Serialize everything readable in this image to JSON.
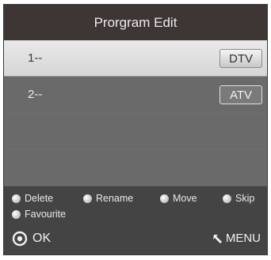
{
  "header": {
    "title": "Prorgram Edit"
  },
  "programs": [
    {
      "number": "1--",
      "type": "DTV",
      "selected": true
    },
    {
      "number": "2--",
      "type": "ATV",
      "selected": false
    },
    {
      "number": "",
      "type": "",
      "selected": false
    },
    {
      "number": "",
      "type": "",
      "selected": false
    }
  ],
  "legend": {
    "delete": "Delete",
    "rename": "Rename",
    "move": "Move",
    "skip": "Skip",
    "favourite": "Favourite"
  },
  "footer": {
    "ok_label": "OK",
    "menu_label": "MENU"
  },
  "icons": {
    "ok": "ok-circle-icon",
    "menu": "return-arrow-icon",
    "legend": "dot-icon"
  },
  "colors": {
    "header_bg": "#3d3634",
    "panel_bg": "#5a5a5a",
    "legend_bg": "#444444"
  }
}
